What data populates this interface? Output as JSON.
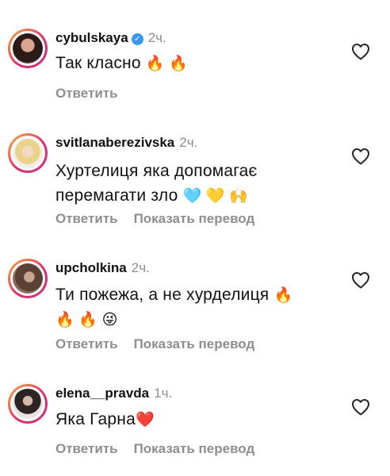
{
  "comments": [
    {
      "username": "cybulskaya",
      "verified": true,
      "time": "2ч.",
      "text": "Так класно",
      "emoji": "🔥 🔥",
      "reply": "Ответить",
      "translate": "",
      "heart_icon": "heart-outline-icon"
    },
    {
      "username": "svitlanaberezivska",
      "verified": false,
      "time": "2ч.",
      "text_line1": "Хуртелиця яка допомагає",
      "text_line2": "перемагати зло",
      "emoji": "🩵 💛 🙌",
      "reply": "Ответить",
      "translate": "Показать перевод",
      "heart_icon": "heart-outline-icon"
    },
    {
      "username": "upcholkina",
      "verified": false,
      "time": "2ч.",
      "text_line1": "Ти пожежа, а не хурделиця",
      "emoji1": "🔥",
      "emoji2": "🔥 🔥 😜",
      "reply": "Ответить",
      "translate": "Показать перевод",
      "heart_icon": "heart-outline-icon"
    },
    {
      "username": "elena__pravda",
      "verified": false,
      "time": "1ч.",
      "text": "Яка Гарна",
      "emoji": "❤️",
      "reply": "Ответить",
      "translate": "Показать перевод",
      "heart_icon": "heart-outline-icon"
    }
  ]
}
